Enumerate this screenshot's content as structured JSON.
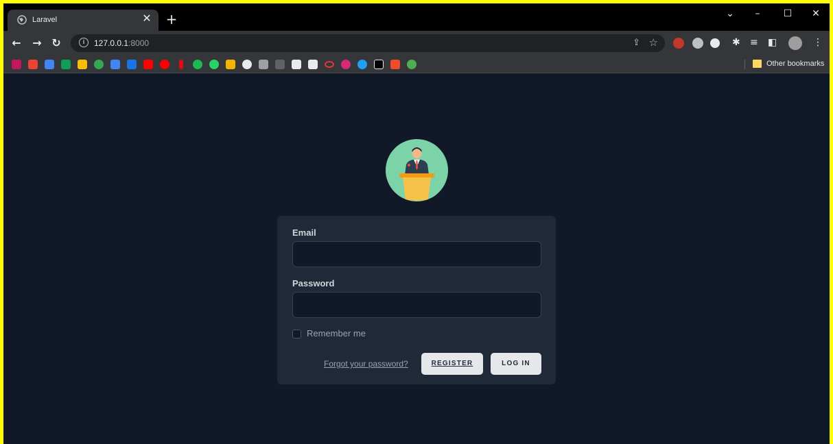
{
  "browser": {
    "tab": {
      "title": "Laravel"
    },
    "url": {
      "host": "127.0.0.1",
      "port": ":8000"
    },
    "bookmarks_other_label": "Other bookmarks"
  },
  "form": {
    "email_label": "Email",
    "email_value": "",
    "password_label": "Password",
    "password_value": "",
    "remember_label": "Remember me",
    "forgot_label": "Forgot your password?",
    "register_label": "REGISTER",
    "login_label": "LOG IN"
  },
  "colors": {
    "highlight_border": "#ffff00",
    "page_bg": "#111827",
    "card_bg": "#1f2937",
    "button_bg": "#e5e7eb",
    "logo_circle": "#7dd3a8",
    "logo_podium": "#f6c34a"
  },
  "icons": {
    "tab_favicon": "globe-icon",
    "tab_close": "close-icon",
    "new_tab": "plus-icon",
    "back": "arrow-left-icon",
    "forward": "arrow-right-icon",
    "reload": "reload-icon",
    "site_info": "info-icon",
    "share": "share-icon",
    "bookmark": "star-icon",
    "logo": "speaker-at-podium-icon"
  }
}
